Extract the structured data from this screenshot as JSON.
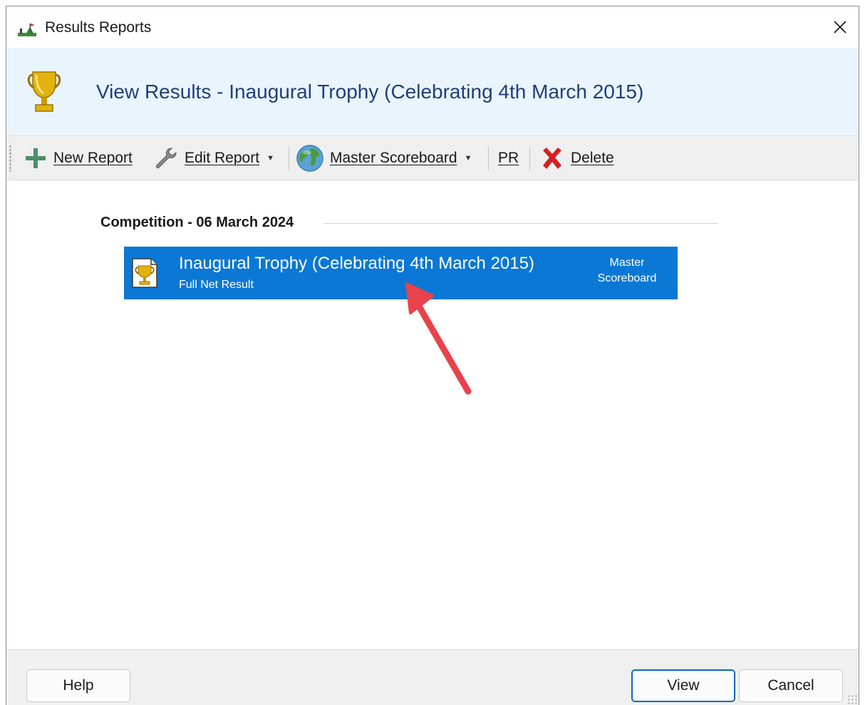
{
  "window": {
    "title": "Results Reports",
    "close_glyph": "✕"
  },
  "header": {
    "title": "View Results - Inaugural Trophy (Celebrating 4th March 2015)",
    "icon": "trophy-icon"
  },
  "toolbar": {
    "new_report": "New Report",
    "edit_report": "Edit Report",
    "master_scoreboard": "Master Scoreboard",
    "pr": "PR",
    "delete": "Delete",
    "dropdown_glyph": "▼"
  },
  "content": {
    "group_heading": "Competition - 06 March 2024",
    "reports": [
      {
        "title": "Inaugural Trophy (Celebrating 4th March 2015)",
        "subtitle": "Full Net Result",
        "tag_line1": "Master",
        "tag_line2": "Scoreboard",
        "selected": true
      }
    ]
  },
  "footer": {
    "help": "Help",
    "view": "View",
    "cancel": "Cancel"
  },
  "colors": {
    "header_bg": "#eaf4fc",
    "header_title": "#1f3f7a",
    "selection": "#0a78d4",
    "annotation_arrow": "#e8424a",
    "delete_red": "#d42020",
    "plus_green": "#4a8f6a"
  }
}
